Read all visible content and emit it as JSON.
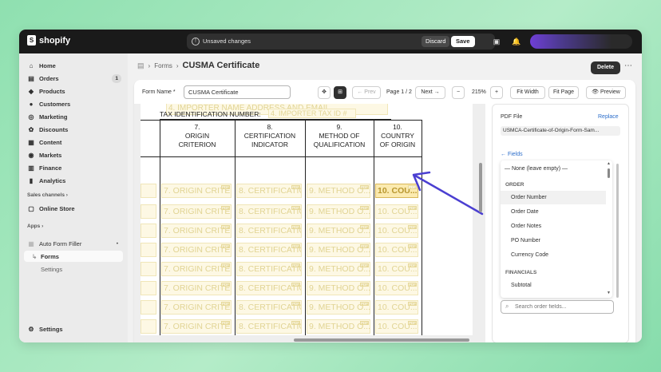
{
  "topbar": {
    "logo_text": "shopify",
    "unsaved_text": "Unsaved changes",
    "discard_label": "Discard",
    "save_label": "Save"
  },
  "sidebar": {
    "items": [
      {
        "label": "Home",
        "icon": "home-icon"
      },
      {
        "label": "Orders",
        "icon": "orders-icon",
        "badge": "1"
      },
      {
        "label": "Products",
        "icon": "products-icon"
      },
      {
        "label": "Customers",
        "icon": "customers-icon"
      },
      {
        "label": "Marketing",
        "icon": "marketing-icon"
      },
      {
        "label": "Discounts",
        "icon": "discounts-icon"
      },
      {
        "label": "Content",
        "icon": "content-icon"
      },
      {
        "label": "Markets",
        "icon": "markets-icon"
      },
      {
        "label": "Finance",
        "icon": "finance-icon"
      },
      {
        "label": "Analytics",
        "icon": "analytics-icon"
      }
    ],
    "sales_channels_label": "Sales channels",
    "online_store_label": "Online Store",
    "apps_label": "Apps",
    "app_name": "Auto Form Filler",
    "app_subitems": [
      "Forms",
      "Settings"
    ],
    "settings_label": "Settings"
  },
  "breadcrumb": {
    "parent": "Forms",
    "title": "CUSMA Certificate"
  },
  "header": {
    "delete_label": "Delete"
  },
  "toolbar": {
    "form_name_label": "Form Name *",
    "form_name_value": "CUSMA Certificate",
    "prev_label": "← Prev",
    "page_info": "Page 1 / 2",
    "next_label": "Next →",
    "zoom_minus": "−",
    "zoom_value": "215%",
    "zoom_plus": "+",
    "fit_width_label": "Fit Width",
    "fit_page_label": "Fit Page",
    "preview_label": "Preview"
  },
  "pdf": {
    "importer_text": "4. IMPORTER NAME ADDRESS AND EMAIL",
    "tax_id_label": "TAX IDENTIFICATION NUMBER:",
    "tax_id_field": "4. IMPORTER TAX ID #",
    "columns": [
      {
        "num": "7.",
        "line1": "ORIGIN",
        "line2": "CRITERION",
        "field": "7. ORIGIN CRITE..."
      },
      {
        "num": "8.",
        "line1": "CERTIFICATION",
        "line2": "INDICATOR",
        "field": "8. CERTIFICATIO..."
      },
      {
        "num": "9.",
        "line1": "METHOD OF",
        "line2": "QUALIFICATION",
        "field": "9. METHOD O..."
      },
      {
        "num": "10.",
        "line1": "COUNTRY",
        "line2": "OF ORIGIN",
        "field": "10. COU..."
      }
    ],
    "pdf_tag": "PDF"
  },
  "right_panel": {
    "pdf_file_label": "PDF File",
    "replace_label": "Replace",
    "file_name": "USMCA-Certificate-of-Origin-Form-Sam...",
    "fields_label": "← Fields",
    "dropdown": {
      "none_option": "— None (leave empty) —",
      "group_order": "ORDER",
      "order_items": [
        "Order Number",
        "Order Date",
        "Order Notes",
        "PO Number",
        "Currency Code"
      ],
      "group_financials": "FINANCIALS",
      "financial_items": [
        "Subtotal"
      ]
    },
    "search_placeholder": "Search order fields..."
  },
  "colors": {
    "accent_blue": "#2c6ecb",
    "arrow": "#4b3fd1",
    "field_fill": "#fdf8e4",
    "selected_field": "#fbeab0"
  }
}
